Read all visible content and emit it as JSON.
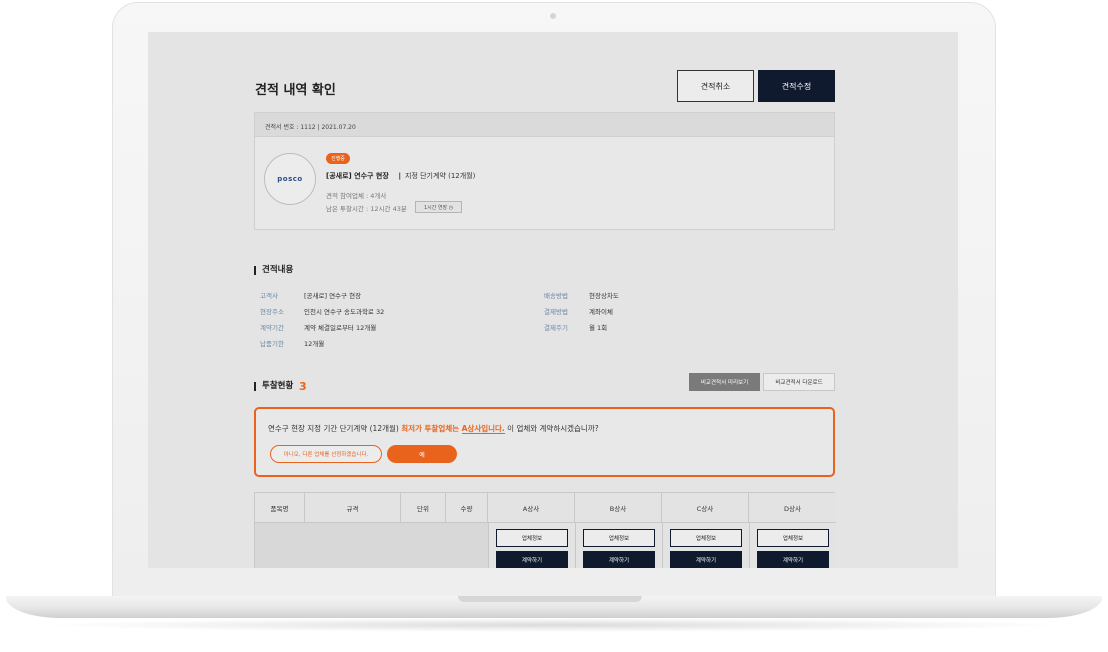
{
  "page": {
    "title": "견적 내역 확인",
    "cancel_label": "견적취소",
    "edit_label": "견적수정"
  },
  "estimate": {
    "header": "견적서 번호 : 1112  |  2021.07.20",
    "logo_text": "posco",
    "status": "진행중",
    "project_name": "[공새로] 연수구 현장",
    "separator": "|",
    "contract_type": "지정 단기계약 (12개월)",
    "participants": "견적 참여업체 : 4개사",
    "remaining_time": "남은 투찰시간 : 12시간 43분",
    "time_chip": "1시간 연장 ◷"
  },
  "details": {
    "title": "견적내용",
    "left": [
      {
        "label": "고객사",
        "value": "[공새로] 연수구 현장"
      },
      {
        "label": "현장주소",
        "value": "인천시 연수구 송도과학로 32"
      },
      {
        "label": "계약기간",
        "value": "계약 체결일로부터 12개월"
      },
      {
        "label": "납품기한",
        "value": "12개월"
      }
    ],
    "right": [
      {
        "label": "배송방법",
        "value": "현장상차도"
      },
      {
        "label": "결제방법",
        "value": "계좌이체"
      },
      {
        "label": "결제주기",
        "value": "월 1회"
      }
    ]
  },
  "bids": {
    "title": "투찰현황",
    "count": "3",
    "preview_label": "비교견적서 미리보기",
    "download_label": "비교견적서 다운로드",
    "alert_prefix": "연수구 현장 지정 기간 단기계약 (12개월) ",
    "alert_highlight1": "최저가 투찰업체는 ",
    "alert_highlight2": "A상사입니다.",
    "alert_suffix": " 이 업체와 계약하시겠습니까?",
    "no_label": "아니오, 다른 업체를 선정하겠습니다.",
    "yes_label": "예"
  },
  "table": {
    "headers": [
      "품목명",
      "규격",
      "단위",
      "수량"
    ],
    "vendors": [
      {
        "name": "A상사",
        "info": "업체정보",
        "contract": "계약하기"
      },
      {
        "name": "B상사",
        "info": "업체정보",
        "contract": "계약하기"
      },
      {
        "name": "C상사",
        "info": "업체정보",
        "contract": "계약하기"
      },
      {
        "name": "D상사",
        "info": "업체정보",
        "contract": "계약하기"
      }
    ]
  },
  "colors": {
    "accent": "#e9631c",
    "navy": "#0f1a2e",
    "screen_bg": "#e4e4e4"
  }
}
